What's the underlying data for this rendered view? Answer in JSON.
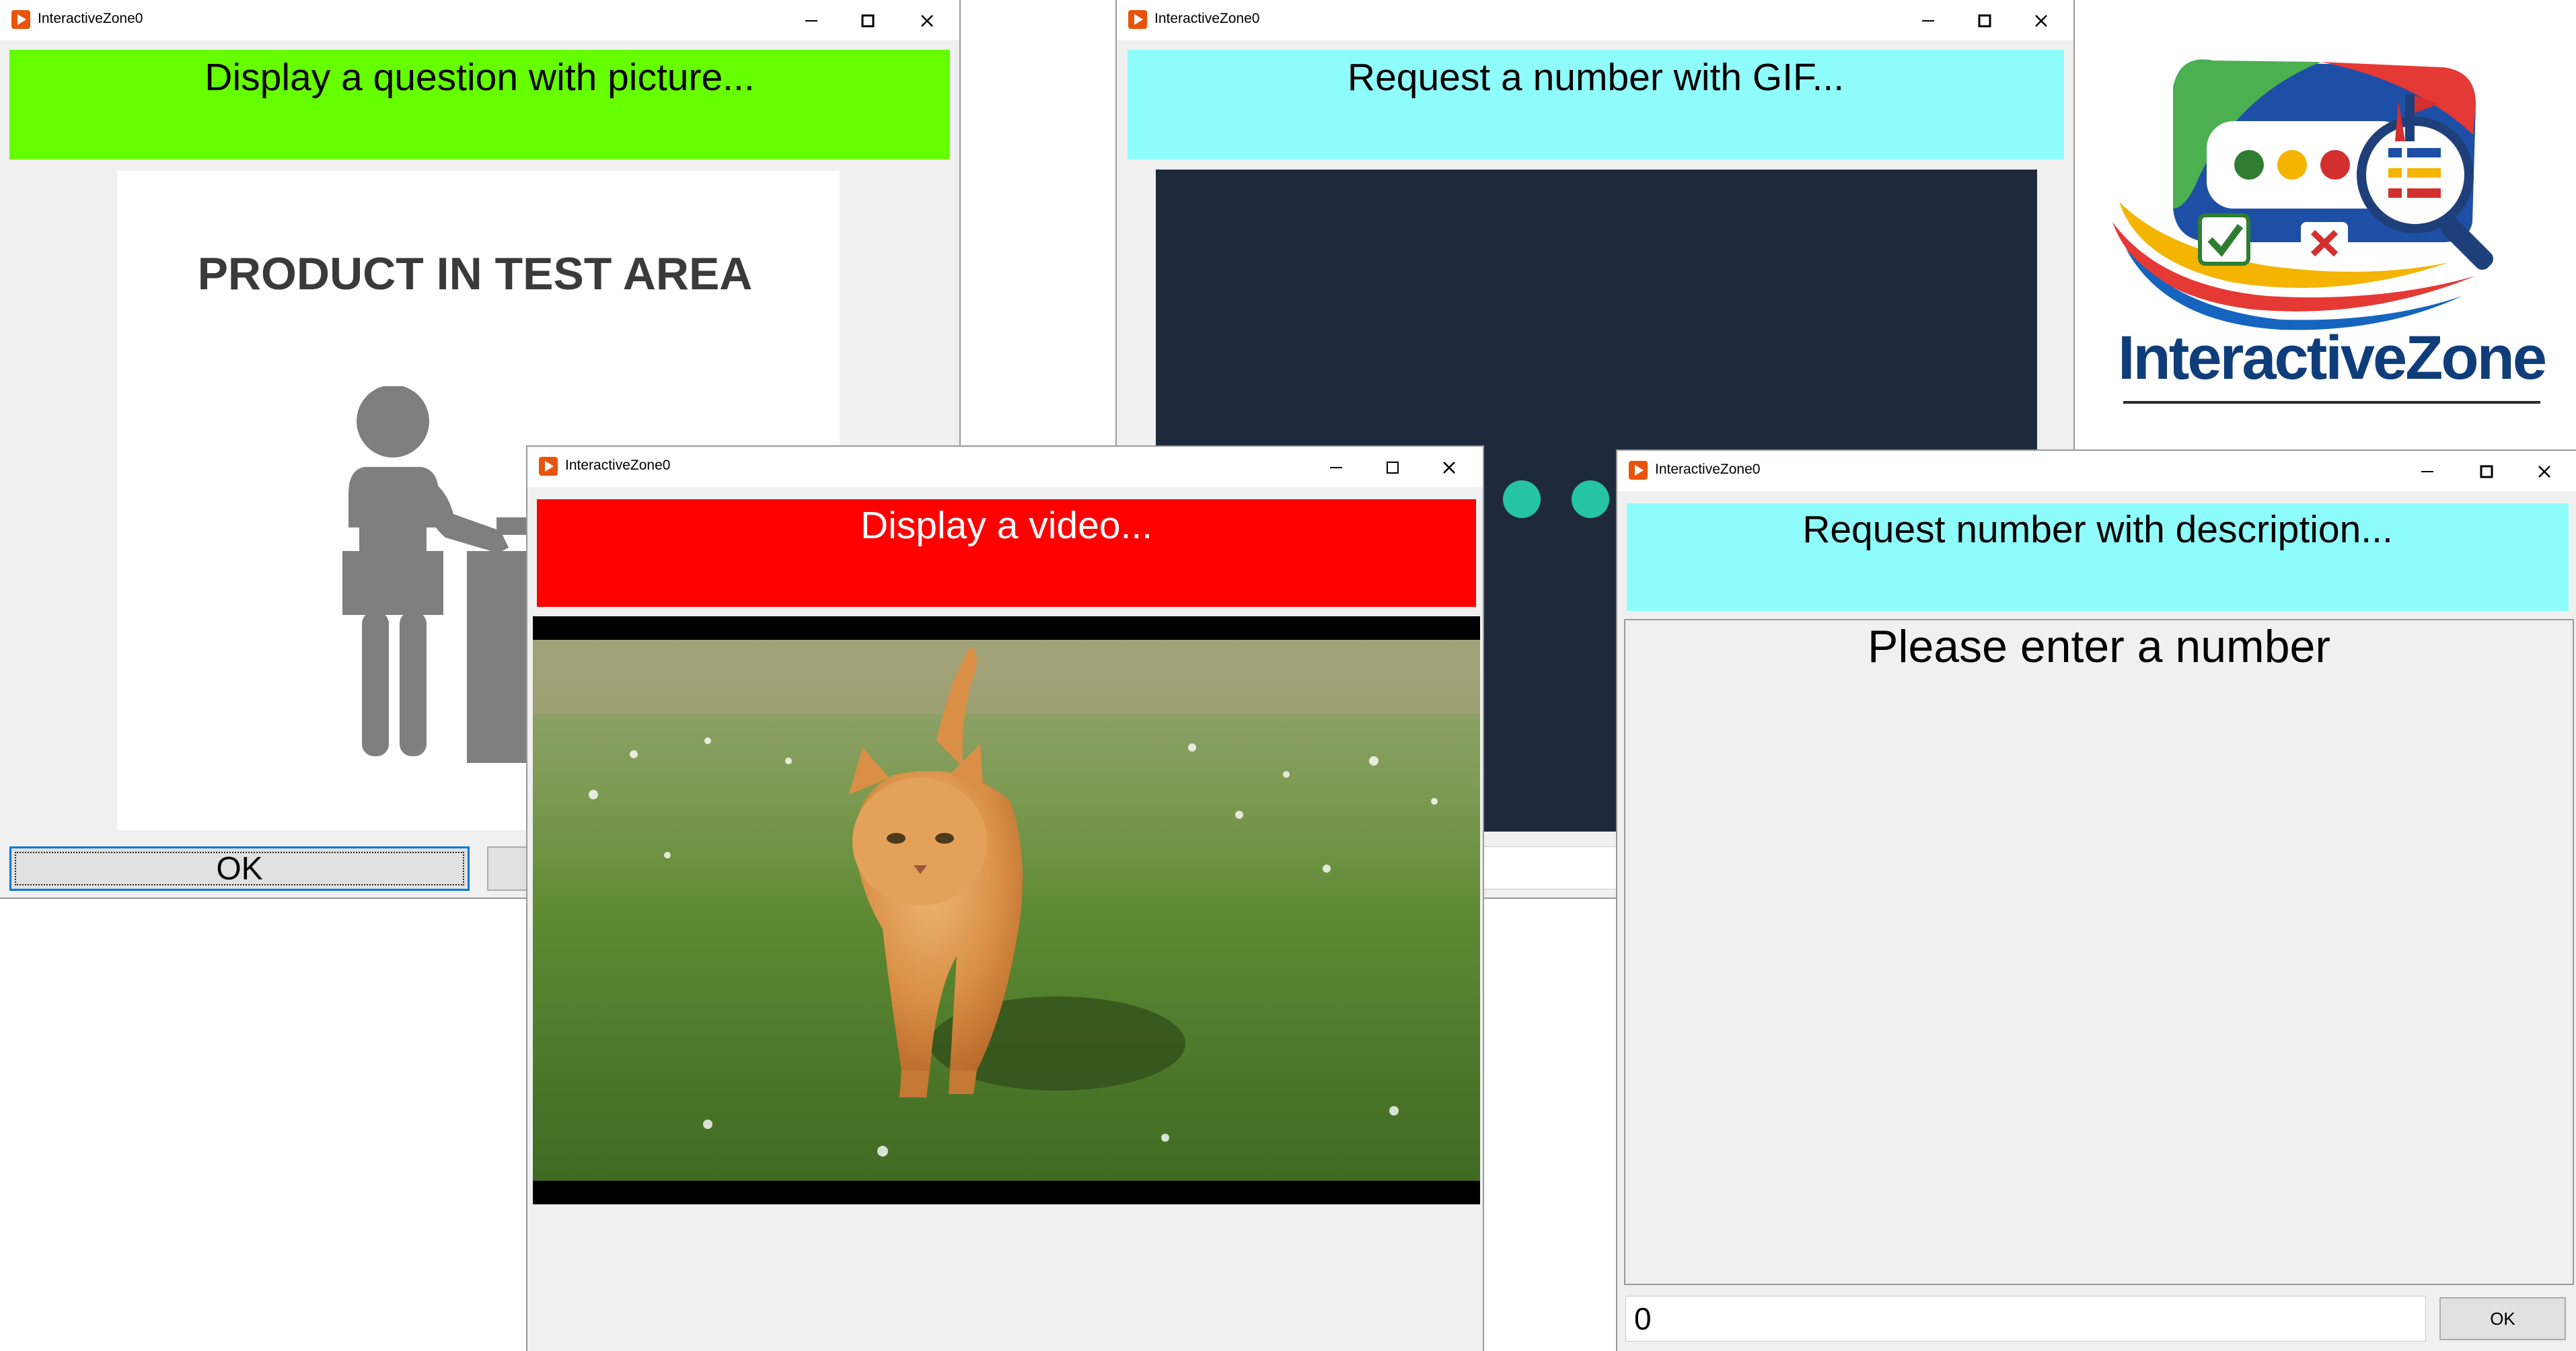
{
  "windows": {
    "picture": {
      "title": "InteractiveZone0",
      "banner": "Display a question with picture...",
      "banner_color": "#66ff00",
      "image_heading": "PRODUCT IN TEST AREA",
      "ok_label": "OK"
    },
    "gif": {
      "title": "InteractiveZone0",
      "banner": "Request a number with GIF...",
      "banner_color": "#8ffcfc",
      "gif_background": "#1e2a3c",
      "dot_color": "#25c4a6"
    },
    "video": {
      "title": "InteractiveZone0",
      "banner": "Display a video...",
      "banner_color": "#ff0000"
    },
    "description": {
      "title": "InteractiveZone0",
      "banner": "Request number with description...",
      "banner_color": "#8ffcfc",
      "description": "Please enter a number",
      "number_value": "0",
      "ok_label": "OK"
    }
  },
  "logo": {
    "brand": "InteractiveZone"
  },
  "icons": {
    "app": "play-icon",
    "minimize": "minimize-icon",
    "maximize": "maximize-icon",
    "close": "close-icon"
  }
}
